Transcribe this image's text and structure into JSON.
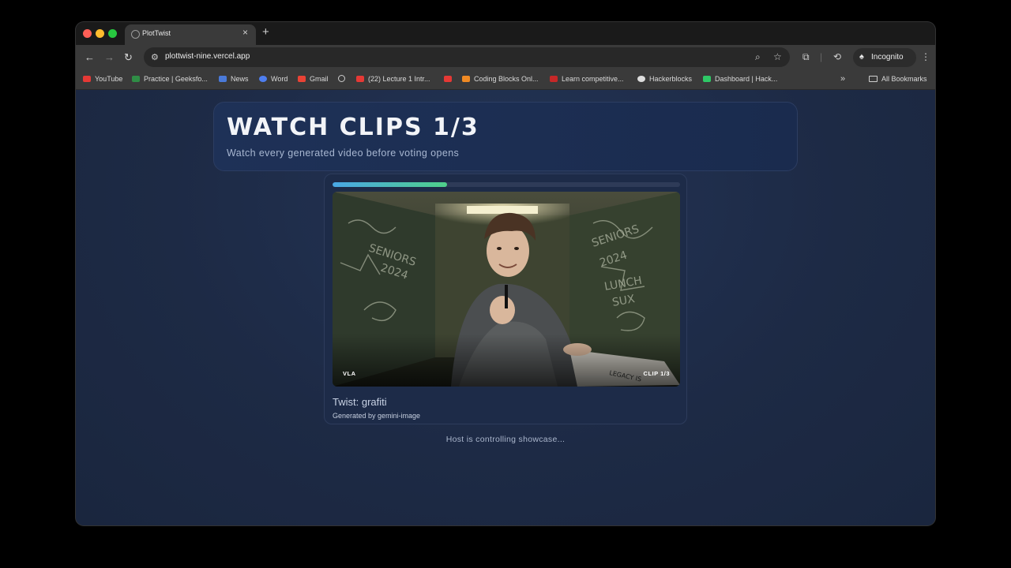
{
  "browser": {
    "tab_title": "PlotTwist",
    "url": "plottwist-nine.vercel.app",
    "profile_label": "Incognito",
    "bookmarks": [
      {
        "label": "YouTube",
        "icon": "youtube-icon",
        "color": "#e53935"
      },
      {
        "label": "Practice | Geeksfo...",
        "icon": "geeksforgeeks-icon",
        "color": "#2f8d46"
      },
      {
        "label": "News",
        "icon": "news-icon",
        "color": "#4a7ad9"
      },
      {
        "label": "Word",
        "icon": "word-icon",
        "color": "#4e7ef0"
      },
      {
        "label": "Gmail",
        "icon": "gmail-icon",
        "color": "#ea4335"
      },
      {
        "label": "",
        "icon": "globe-icon",
        "color": "#cccccc"
      },
      {
        "label": "(22) Lecture 1 Intr...",
        "icon": "youtube-icon",
        "color": "#e53935"
      },
      {
        "label": "",
        "icon": "youtube-icon",
        "color": "#e53935"
      },
      {
        "label": "Coding Blocks Onl...",
        "icon": "codingblocks-icon",
        "color": "#f08a24"
      },
      {
        "label": "Learn competitive...",
        "icon": "learn-icon",
        "color": "#c62828"
      },
      {
        "label": "Hackerblocks",
        "icon": "hackerblocks-icon",
        "color": "#dddddd"
      },
      {
        "label": "Dashboard | Hack...",
        "icon": "hackerrank-icon",
        "color": "#2ec866"
      }
    ],
    "all_bookmarks_label": "All Bookmarks"
  },
  "page": {
    "title": "WATCH CLIPS 1/3",
    "subtitle": "Watch every generated video before voting opens",
    "clip": {
      "progress": 0.33,
      "left_tag": "VLA",
      "right_tag": "CLIP 1/3",
      "title": "Twist: grafiti",
      "credit": "Generated by gemini-image"
    },
    "status": "Host is controlling showcase..."
  }
}
